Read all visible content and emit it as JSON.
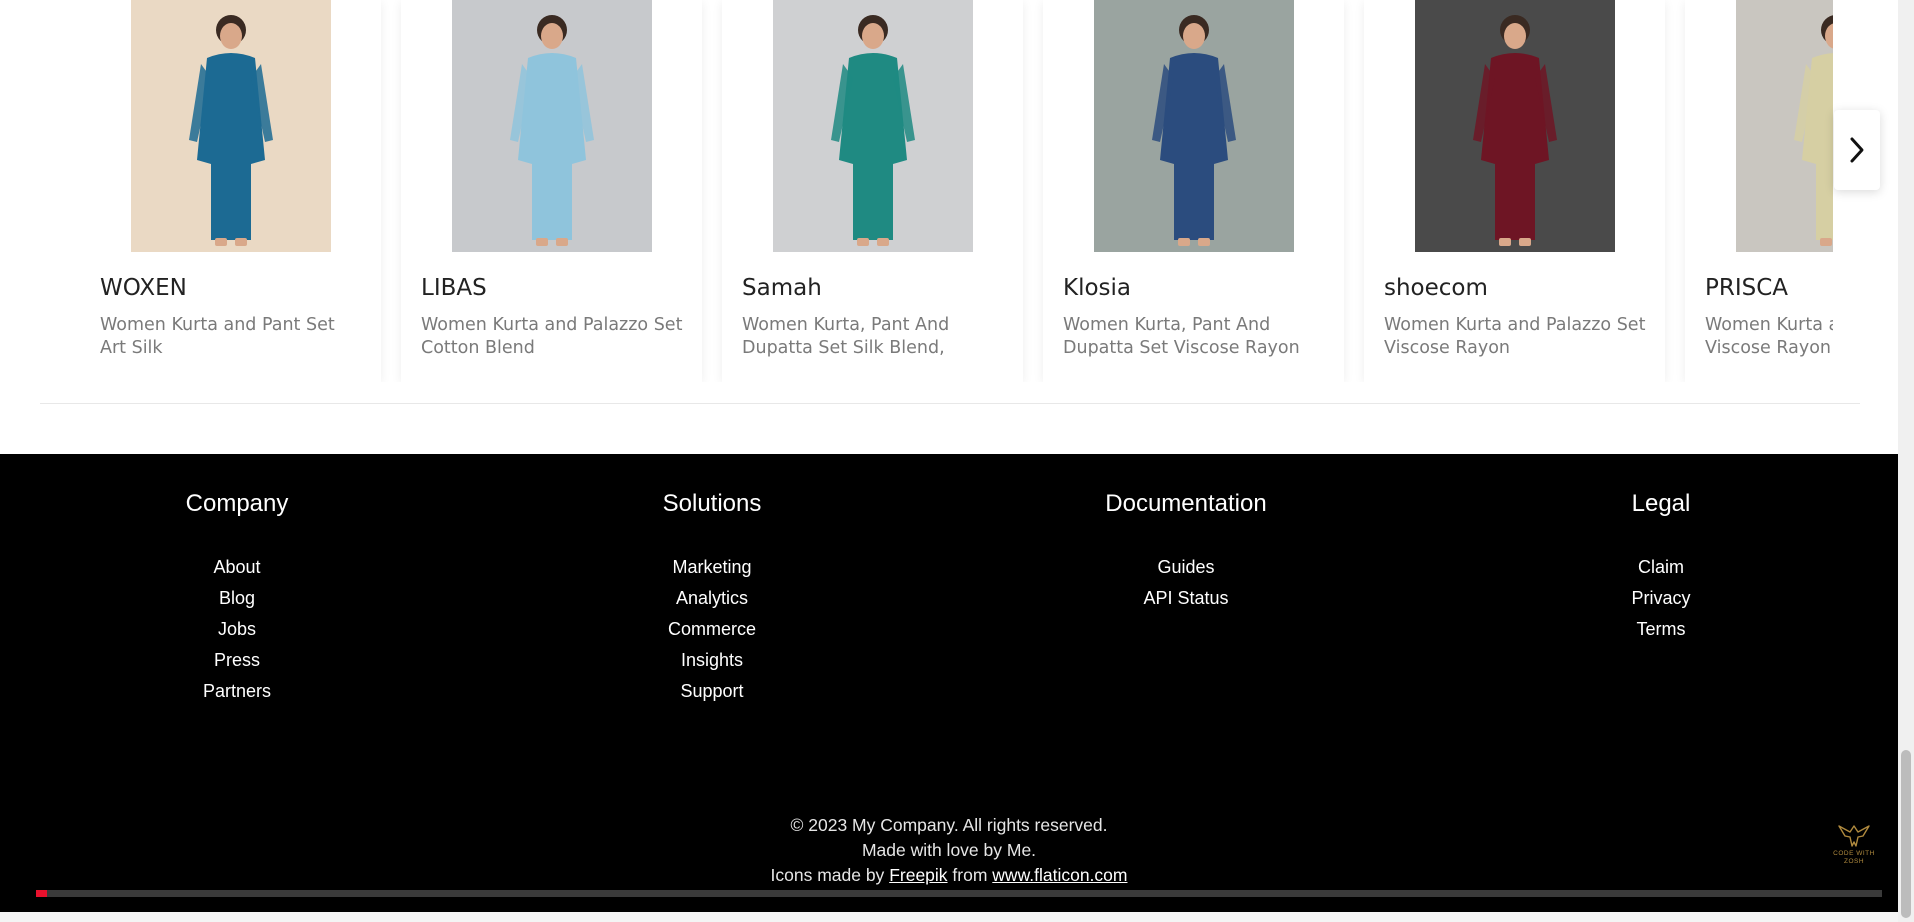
{
  "carousel": {
    "products": [
      {
        "brand": "WOXEN",
        "description": "Women Kurta and Pant Set Art Silk",
        "bg_color": "#ead9c4",
        "garment_color": "#1c6a93"
      },
      {
        "brand": "LIBAS",
        "description": "Women Kurta and Palazzo Set Cotton Blend",
        "bg_color": "#c7c9cc",
        "garment_color": "#8fc4dc"
      },
      {
        "brand": "Samah",
        "description": "Women Kurta, Pant And Dupatta Set Silk Blend, Cotton Bl...",
        "bg_color": "#cfd0d2",
        "garment_color": "#1f8a82"
      },
      {
        "brand": "Klosia",
        "description": "Women Kurta, Pant And Dupatta Set Viscose Rayon",
        "bg_color": "#9aa4a0",
        "garment_color": "#2b4c7e"
      },
      {
        "brand": "shoecom",
        "description": "Women Kurta and Palazzo Set Viscose Rayon",
        "bg_color": "#4a4a4a",
        "garment_color": "#6e1524"
      },
      {
        "brand": "PRISCA",
        "description": "Women Kurta and Palazzo Set Viscose Rayon",
        "bg_color": "#c9c6c0",
        "garment_color": "#d6cfa3"
      }
    ],
    "next_icon": "chevron-right-icon"
  },
  "footer": {
    "columns": [
      {
        "title": "Company",
        "links": [
          "About",
          "Blog",
          "Jobs",
          "Press",
          "Partners"
        ]
      },
      {
        "title": "Solutions",
        "links": [
          "Marketing",
          "Analytics",
          "Commerce",
          "Insights",
          "Support"
        ]
      },
      {
        "title": "Documentation",
        "links": [
          "Guides",
          "API Status"
        ]
      },
      {
        "title": "Legal",
        "links": [
          "Claim",
          "Privacy",
          "Terms"
        ]
      }
    ],
    "copyright": "© 2023 My Company. All rights reserved.",
    "made_with": "Made with love by Me.",
    "icons_prefix": "Icons made by",
    "icons_author": "Freepik",
    "icons_from": "from",
    "icons_site": "www.flaticon.com",
    "logo_text": "CODE WITH ZOSH",
    "video_progress": 0.006,
    "progress_color": "#e8112d"
  }
}
